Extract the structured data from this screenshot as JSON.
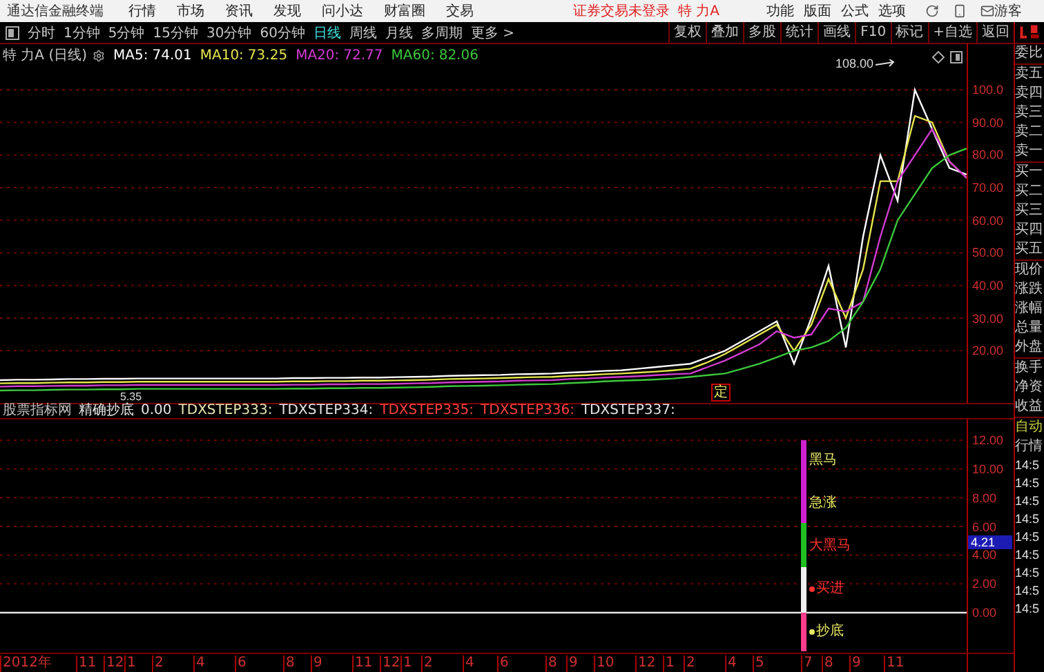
{
  "menu_bar": {
    "app_title": "通达信金融终端",
    "menus": [
      "行情",
      "市场",
      "资讯",
      "发现",
      "问小达",
      "财富圈",
      "交易"
    ],
    "status": "证券交易未登录",
    "stock": "特 力A",
    "actions": [
      "功能",
      "版面",
      "公式",
      "选项"
    ],
    "user": "游客"
  },
  "toolbar": {
    "periods": [
      {
        "label": "分时",
        "selected": false
      },
      {
        "label": "1分钟",
        "selected": false
      },
      {
        "label": "5分钟",
        "selected": false
      },
      {
        "label": "15分钟",
        "selected": false
      },
      {
        "label": "30分钟",
        "selected": false
      },
      {
        "label": "60分钟",
        "selected": false
      },
      {
        "label": "日线",
        "selected": true
      },
      {
        "label": "周线",
        "selected": false
      },
      {
        "label": "月线",
        "selected": false
      },
      {
        "label": "多周期",
        "selected": false
      },
      {
        "label": "更多 >",
        "selected": false
      }
    ],
    "tools": [
      "复权",
      "叠加",
      "多股",
      "统计",
      "画线",
      "F10",
      "标记",
      "+自选",
      "返回"
    ]
  },
  "price_chart": {
    "title": "特 力A (日线)",
    "ma_values": [
      "74.01",
      "73.25",
      "72.77",
      "82.06"
    ],
    "high_label": "108.00",
    "low_label": "5.35",
    "marker": "定",
    "chart_data": {
      "type": "line",
      "categories": [
        null,
        null,
        null,
        null,
        null,
        null,
        null,
        null,
        null,
        null,
        null,
        null,
        null,
        null,
        null,
        null,
        null,
        null,
        null,
        null,
        null,
        null,
        null,
        null,
        null,
        null,
        null,
        null,
        null,
        null,
        null,
        null,
        null,
        null,
        null,
        null,
        null,
        null,
        null,
        null,
        null,
        null,
        null,
        null,
        null,
        null,
        null,
        null,
        null,
        null,
        null,
        null,
        null,
        null,
        null,
        null,
        null
      ],
      "ylim": [
        4,
        114
      ],
      "grid": true,
      "yticks": [
        {
          "value": 20,
          "label": "20.00"
        },
        {
          "value": 30,
          "label": "30.00"
        },
        {
          "value": 40,
          "label": "40.00"
        },
        {
          "value": 50,
          "label": "50.00"
        },
        {
          "value": 60,
          "label": "60.00"
        },
        {
          "value": 70,
          "label": "70.00"
        },
        {
          "value": 80,
          "label": "80.00"
        },
        {
          "value": 90,
          "label": "90.00"
        },
        {
          "value": 100,
          "label": "100.0"
        }
      ],
      "series": [
        {
          "name": "MA5:",
          "color": "#ffffff",
          "values": [
            11,
            11.1,
            11.1,
            11.2,
            11.3,
            11.3,
            11.4,
            11.4,
            11.5,
            11.5,
            11.5,
            11.5,
            11.5,
            11.5,
            11.5,
            11.5,
            11.5,
            11.6,
            11.6,
            11.7,
            11.7,
            11.8,
            11.8,
            11.9,
            12,
            12.1,
            12.3,
            12.4,
            12.5,
            12.6,
            12.8,
            12.9,
            13,
            13.3,
            13.5,
            13.8,
            14,
            14.5,
            15,
            15.5,
            16,
            18,
            20,
            23,
            26,
            29,
            16,
            30,
            46,
            21,
            55,
            80,
            66,
            100,
            88,
            76,
            74
          ]
        },
        {
          "name": "MA10:",
          "color": "#e6e64c",
          "values": [
            10,
            10.1,
            10.1,
            10.2,
            10.3,
            10.3,
            10.4,
            10.4,
            10.5,
            10.5,
            10.5,
            10.5,
            10.5,
            10.5,
            10.5,
            10.5,
            10.5,
            10.6,
            10.6,
            10.7,
            10.7,
            10.8,
            10.8,
            10.9,
            11,
            11.1,
            11.3,
            11.4,
            11.5,
            11.6,
            11.8,
            11.9,
            12,
            12.3,
            12.5,
            12.8,
            13,
            13.3,
            13.6,
            14,
            14.5,
            16.5,
            19,
            22,
            25,
            28,
            20,
            28,
            42,
            30,
            45,
            72,
            72,
            92,
            90,
            78,
            73
          ]
        },
        {
          "name": "MA20:",
          "color": "#d23cd2",
          "values": [
            9,
            9.1,
            9.1,
            9.2,
            9.3,
            9.3,
            9.4,
            9.4,
            9.5,
            9.5,
            9.5,
            9.5,
            9.5,
            9.5,
            9.5,
            9.5,
            9.5,
            9.6,
            9.6,
            9.7,
            9.7,
            9.8,
            9.8,
            9.9,
            10,
            10.1,
            10.3,
            10.4,
            10.5,
            10.6,
            10.8,
            10.9,
            11,
            11.3,
            11.5,
            11.8,
            12,
            12.2,
            12.5,
            12.8,
            13,
            15,
            17,
            19.5,
            22,
            26,
            24,
            25,
            33,
            32,
            35,
            55,
            72,
            80,
            88,
            78,
            73
          ]
        },
        {
          "name": "MA60:",
          "color": "#3cc83c",
          "values": [
            7.8,
            7.9,
            7.9,
            8,
            8.1,
            8.1,
            8.2,
            8.2,
            8.3,
            8.3,
            8.3,
            8.3,
            8.3,
            8.3,
            8.3,
            8.3,
            8.3,
            8.4,
            8.4,
            8.5,
            8.5,
            8.6,
            8.6,
            8.7,
            8.8,
            8.9,
            9.1,
            9.2,
            9.3,
            9.4,
            9.6,
            9.7,
            9.8,
            10.1,
            10.3,
            10.6,
            10.8,
            11,
            11.2,
            11.5,
            12,
            12.5,
            13,
            14.5,
            16,
            18,
            20,
            21,
            23,
            27,
            35,
            45,
            60,
            68,
            76,
            80,
            82
          ]
        }
      ]
    }
  },
  "time_axis": [
    "2012年",
    "11",
    "12",
    "1",
    "2",
    "4",
    "6",
    "8",
    "9",
    "11",
    "12",
    "1",
    "2",
    "4",
    "6",
    "8",
    "9",
    "10",
    "12",
    "1",
    "2",
    "4",
    "5",
    "7",
    "8",
    "9",
    "11"
  ],
  "indicator": {
    "name": "股票指标网",
    "formula": "精确抄底",
    "value": "0.00",
    "outputs": [
      {
        "text": "TDXSTEP333:",
        "color": "#e6e6b4"
      },
      {
        "text": "TDXSTEP334:",
        "color": "#e6e6e6"
      },
      {
        "text": "TDXSTEP335:",
        "color": "#ff4040"
      },
      {
        "text": "TDXSTEP336:",
        "color": "#ff4040"
      },
      {
        "text": "TDXSTEP337:",
        "color": "#e6e6e6"
      }
    ],
    "axis_labels": [
      "12.00",
      "10.00",
      "8.00",
      "6.00",
      "4.00",
      "2.00",
      "0.00"
    ],
    "signals": [
      {
        "text": "黑马",
        "color": "#e6e664",
        "dot": false
      },
      {
        "text": "急涨",
        "color": "#e6e664",
        "dot": false
      },
      {
        "text": "大黑马",
        "color": "#ff3030",
        "dot": false
      },
      {
        "text": "买进",
        "color": "#ff3030",
        "dot": true
      },
      {
        "text": "抄底",
        "color": "#e6e664",
        "dot": true
      }
    ],
    "current_value": "4.21"
  },
  "quote_panel": {
    "groups": [
      [
        "委比"
      ],
      [
        "卖五",
        "卖四",
        "卖三",
        "卖二",
        "卖一"
      ],
      [
        "买一",
        "买二",
        "买三",
        "买四",
        "买五"
      ],
      [
        "现价",
        "涨跌",
        "涨幅",
        "总量",
        "外盘"
      ],
      [
        "换手",
        "净资",
        "收益"
      ]
    ],
    "ticker_title": [
      "自动",
      "行情"
    ],
    "times": [
      "14:5",
      "14:5",
      "14:5",
      "14:5",
      "14:5",
      "14:5",
      "14:5",
      "14:5",
      "14:5"
    ]
  }
}
